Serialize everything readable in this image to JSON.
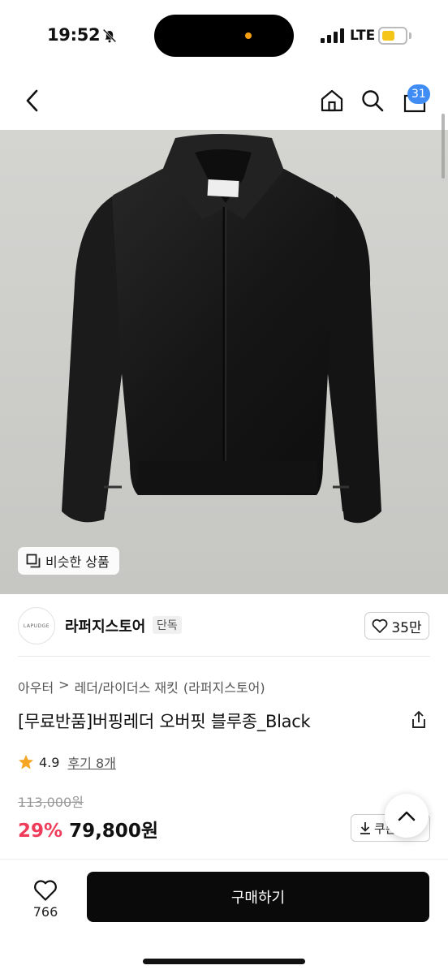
{
  "status": {
    "time": "19:52",
    "network": "LTE",
    "battery_level": 0.55,
    "battery_color": "#f5c518"
  },
  "nav": {
    "cart_count": "31",
    "badge_color": "#3f8cf5"
  },
  "image": {
    "similar_label": "비슷한 상품",
    "brand_tag": "LAPUDGE STORE"
  },
  "seller": {
    "logo_text": "LAPUDGE",
    "name": "라퍼지스토어",
    "tag": "단독",
    "likes": "35만"
  },
  "breadcrumb": [
    "아우터",
    ">",
    "레더/라이더스 재킷",
    "(라퍼지스토어)"
  ],
  "product": {
    "title": "[무료반품]버핑레더 오버핏 블루종_Black",
    "rating": "4.9",
    "review_label": "후기 8개",
    "original_price": "113,000원",
    "discount": "29%",
    "price": "79,800원",
    "coupon_label": "쿠폰"
  },
  "bottom": {
    "wish_count": "766",
    "buy_label": "구매하기"
  },
  "colors": {
    "discount": "#f03c5b",
    "star": "#f5a623",
    "buy_bg": "#0a0a0a"
  }
}
